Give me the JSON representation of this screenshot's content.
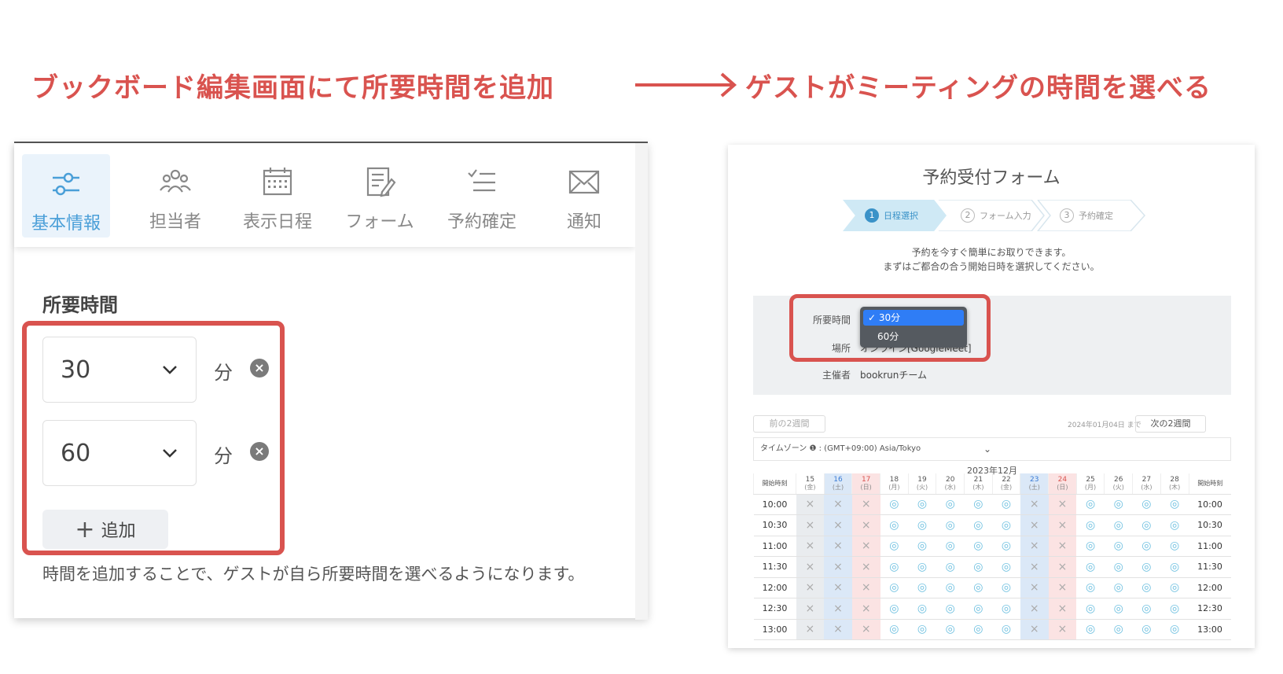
{
  "headings": {
    "left": "ブックボード編集画面にて所要時間を追加",
    "right": "ゲストがミーティングの時間を選べる"
  },
  "editor": {
    "tabs": [
      {
        "label": "基本情報",
        "icon": "sliders-icon",
        "active": true
      },
      {
        "label": "担当者",
        "icon": "people-icon",
        "active": false
      },
      {
        "label": "表示日程",
        "icon": "calendar-icon",
        "active": false
      },
      {
        "label": "フォーム",
        "icon": "form-edit-icon",
        "active": false
      },
      {
        "label": "予約確定",
        "icon": "checklist-icon",
        "active": false
      },
      {
        "label": "通知",
        "icon": "mail-icon",
        "active": false
      }
    ],
    "section_title": "所要時間",
    "durations": [
      {
        "value": "30",
        "unit": "分"
      },
      {
        "value": "60",
        "unit": "分"
      }
    ],
    "add_label": "追加",
    "helper": "時間を追加することで、ゲストが自ら所要時間を選べるようになります。"
  },
  "booking": {
    "title": "予約受付フォーム",
    "steps": [
      {
        "num": "1",
        "label": "日程選択"
      },
      {
        "num": "2",
        "label": "フォーム入力"
      },
      {
        "num": "3",
        "label": "予約確定"
      }
    ],
    "intro_line1": "予約を今すぐ簡単にお取りできます。",
    "intro_line2": "まずはご都合の合う開始日時を選択してください。",
    "duration_label": "所要時間",
    "duration_options": [
      "30分",
      "60分"
    ],
    "duration_selected": "30分",
    "place_label": "場所",
    "place_value": "オンライン[GoogleMeet]",
    "host_label": "主催者",
    "host_value": "bookrunチーム",
    "prev_label": "前の2週間",
    "next_label": "次の2週間",
    "range_note": "2024年01月04日 まで",
    "timezone": "タイムゾーン ❶ : (GMT+09:00) Asia/Tokyo",
    "month": "2023年12月",
    "start_time_header": "開始時刻",
    "days": [
      {
        "d": "15",
        "w": "(金)",
        "type": "x"
      },
      {
        "d": "16",
        "w": "(土)",
        "type": "blue"
      },
      {
        "d": "17",
        "w": "(日)",
        "type": "red"
      },
      {
        "d": "18",
        "w": "(月)",
        "type": "ok"
      },
      {
        "d": "19",
        "w": "(火)",
        "type": "ok"
      },
      {
        "d": "20",
        "w": "(水)",
        "type": "ok"
      },
      {
        "d": "21",
        "w": "(木)",
        "type": "ok"
      },
      {
        "d": "22",
        "w": "(金)",
        "type": "ok"
      },
      {
        "d": "23",
        "w": "(土)",
        "type": "blue"
      },
      {
        "d": "24",
        "w": "(日)",
        "type": "red"
      },
      {
        "d": "25",
        "w": "(月)",
        "type": "ok"
      },
      {
        "d": "26",
        "w": "(火)",
        "type": "ok"
      },
      {
        "d": "27",
        "w": "(水)",
        "type": "ok"
      },
      {
        "d": "28",
        "w": "(木)",
        "type": "ok"
      }
    ],
    "times": [
      "10:00",
      "10:30",
      "11:00",
      "11:30",
      "12:00",
      "12:30",
      "13:00"
    ],
    "available_symbol": "◎",
    "unavailable_symbol": "×"
  },
  "colors": {
    "accent_red": "#d9534f",
    "active_blue": "#4a9fd8",
    "dropdown_blue": "#2f7df6"
  }
}
